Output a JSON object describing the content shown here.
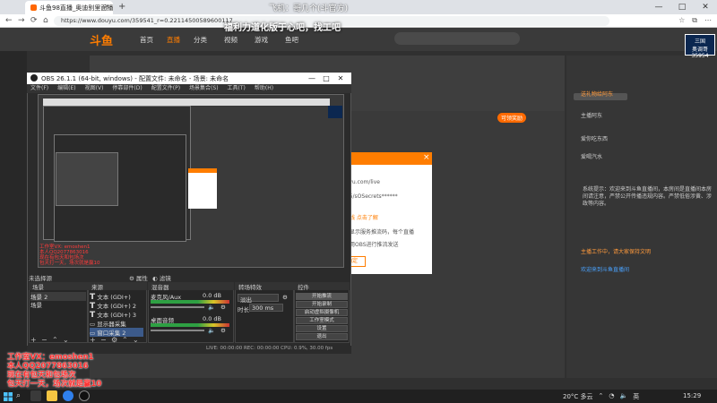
{
  "browser": {
    "tab_title": "斗鱼98直播_奥迪别里面播",
    "overlay_text": "飞机：哥几个(斗官方)",
    "url": "https://www.douyu.com/359541_r=0.22114500589600117",
    "win_min": "—",
    "win_max": "□",
    "win_close": "✕"
  },
  "douyu": {
    "logo": "斗鱼",
    "nav": [
      "首页",
      "直播",
      "分类",
      "视频",
      "游戏",
      "鱼吧"
    ],
    "banner": "福利力道化版于心吧，找工吧",
    "score_pill": "可领奖励",
    "right_logo": "三国\n奥调哥\n35954",
    "right_messages": [
      "送礼物给阿东",
      "主播阿东",
      "爱你吃东西",
      "爱喝汽水"
    ],
    "system_msg": "系统提示：欢迎来到斗鱼直播间，本房间是直播间本房间请注意，严禁公开传播违规内容。严禁低俗涉黄、涉政等内容。",
    "dialog_title": "",
    "dialog_lines": [
      "douyu.com/live",
      "cfr05/sOSecrets******",
      "已上线  点击了解",
      "刷新显示服务推流码，每个直播",
      "请使用OBS进行推流发送"
    ],
    "dialog_btn": "确定",
    "side_msg_1": "主播工作中，请大家保持文明",
    "side_msg_2": "欢迎来到斗鱼直播间"
  },
  "obs": {
    "title": "OBS 26.1.1 (64-bit, windows) - 配置文件: 未命名 - 场景: 未命名",
    "menu": [
      "文件(F)",
      "编辑(E)",
      "视图(V)",
      "停靠部件(D)",
      "配置文件(P)",
      "场景集合(S)",
      "工具(T)",
      "帮助(H)"
    ],
    "dock_label": "未选择源",
    "props_btn": "属性",
    "filter_btn": "滤镜",
    "scenes_head": "场景",
    "scenes": [
      "场景 2",
      "场景"
    ],
    "sources_head": "来源",
    "sources": [
      "文本 (GDI+)",
      "文本 (GDI+) 2",
      "文本 (GDI+) 3",
      "显示器采集",
      "窗口采集 2"
    ],
    "mixer_head": "混音器",
    "mixer": [
      {
        "name": "麦克风/Aux",
        "db": "0.0 dB"
      },
      {
        "name": "桌面音频",
        "db": "0.0 dB"
      }
    ],
    "transitions_head": "转场特效",
    "transition": "淡出",
    "duration_label": "时长",
    "duration": "300 ms",
    "controls_head": "控件",
    "controls": [
      "开始推流",
      "开始录制",
      "启动虚拟摄像机",
      "工作室模式",
      "设置",
      "退出"
    ],
    "status": "LIVE: 00:00:00    REC: 00:00:00    CPU: 0.9%, 30.00 fps",
    "nested_red_text": "工作室VX: emoshen1\n本人QQ2077863016\n现在有包天和包场次\n包天打一天，场次就是赢10"
  },
  "promo": {
    "line1": "工作室VX：emoshen1",
    "line2": "本人QQ2077863016",
    "line3": "现在有包天和包场次",
    "line4": "包天打一天，场次就是赢10"
  },
  "taskbar": {
    "weather": "20°C 多云",
    "lang": "英",
    "time": "15:29"
  },
  "colors": {
    "douyu_orange": "#ff7d00",
    "promo_red": "#ff3030",
    "obs_bg": "#2b2b2b"
  }
}
